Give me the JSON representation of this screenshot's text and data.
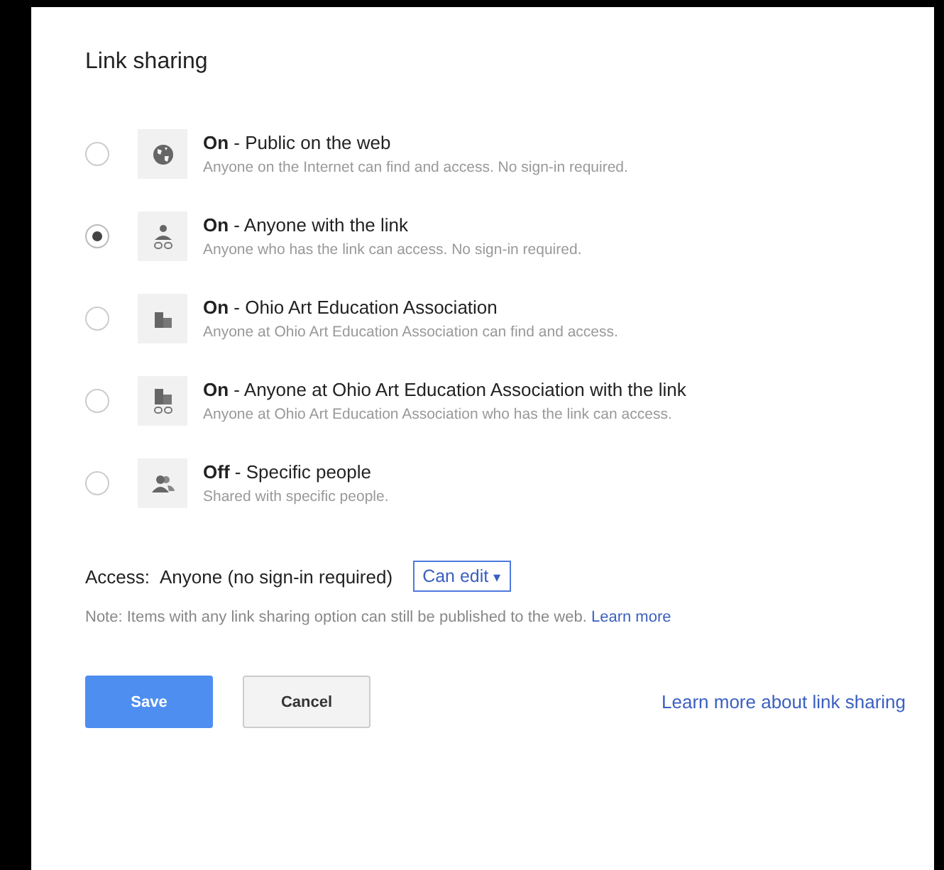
{
  "title": "Link sharing",
  "options": [
    {
      "kind": "public",
      "label": "**On** - Public on the web",
      "description": "Anyone on the Internet can find and access. No sign-in required.",
      "selected": false
    },
    {
      "kind": "link",
      "label": "**On** - Anyone with the link",
      "description": "Anyone who has the link can access. No sign-in required.",
      "selected": true
    },
    {
      "kind": "domain",
      "label": "**On** - Ohio Art Education Association",
      "description": "Anyone at Ohio Art Education Association can find and access.",
      "selected": false
    },
    {
      "kind": "domain_link",
      "label": "**On** - Anyone at Ohio Art Education Association with the link",
      "description": "Anyone at Ohio Art Education Association who has the link can access.",
      "selected": false
    },
    {
      "kind": "people",
      "label": "**Off** - Specific people",
      "description": "Shared with specific people.",
      "selected": false
    }
  ],
  "access": {
    "label": "Access:",
    "value": "Anyone (no sign-in required)",
    "dropdown": "Can edit",
    "caret": "▾"
  },
  "note": {
    "text": "Note: Items with any link sharing option can still be published to the web.",
    "link": "Learn more"
  },
  "buttons": {
    "save": "Save",
    "cancel": "Cancel",
    "help_link": "Learn more about link sharing"
  }
}
